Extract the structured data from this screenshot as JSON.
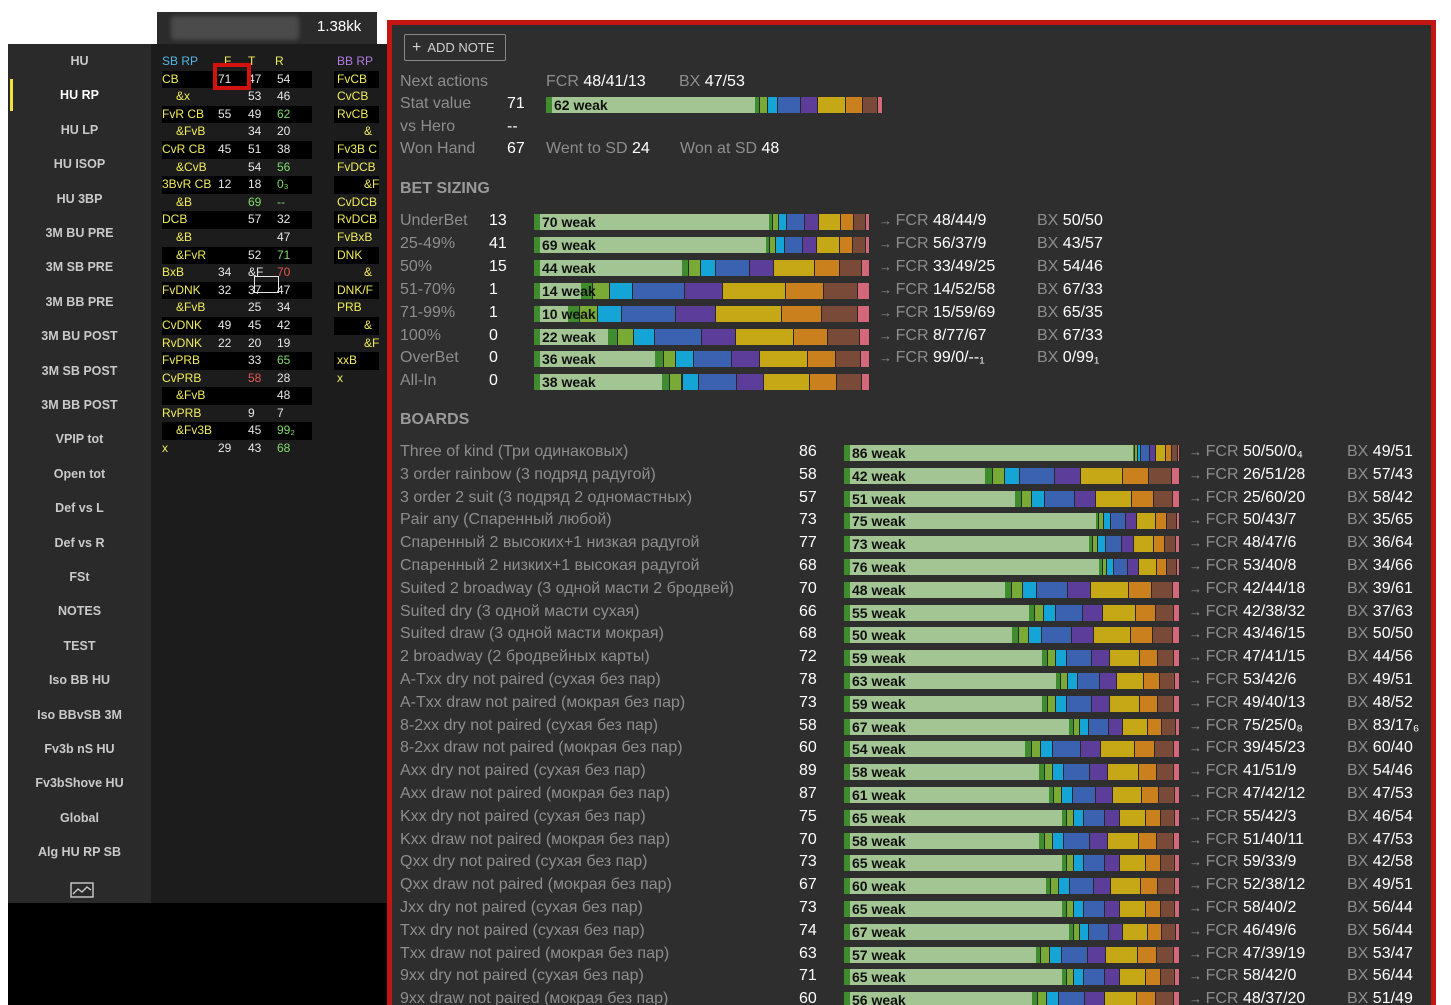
{
  "header": {
    "amount": "1.38kk"
  },
  "nav": {
    "items": [
      "HU",
      "HU RP",
      "HU LP",
      "HU ISOP",
      "HU 3BP",
      "3M BU PRE",
      "3M SB PRE",
      "3M BB PRE",
      "3M BU POST",
      "3M SB POST",
      "3M BB POST",
      "VPIP tot",
      "Open tot",
      "Def vs L",
      "Def vs R",
      "FSt",
      "NOTES",
      "TEST",
      "Iso BB HU",
      "Iso BBvSB 3M",
      "Fv3b nS HU",
      "Fv3bShove HU",
      "Global",
      "Alg HU RP SB"
    ],
    "active": "HU RP",
    "chart_icon": "line-chart-icon"
  },
  "grid_left": {
    "headers": [
      "SB RP",
      "F",
      "T",
      "R"
    ],
    "rows": [
      [
        "CB",
        "71",
        "47",
        "54"
      ],
      [
        "&x",
        "",
        "53",
        "46"
      ],
      [
        "FvR CB",
        "55",
        "49",
        "62"
      ],
      [
        "&FvB",
        "",
        "34",
        "20"
      ],
      [
        "CvR CB",
        "45",
        "51",
        "38"
      ],
      [
        "&CvB",
        "",
        "54",
        "56"
      ],
      [
        "3BvR CB",
        "12",
        "18",
        "0₃"
      ],
      [
        "&B",
        "",
        "69",
        "--"
      ],
      [
        "DCB",
        "",
        "57",
        "32"
      ],
      [
        "&B",
        "",
        "",
        "47"
      ],
      [
        "&FvR",
        "",
        "52",
        "71"
      ],
      [
        "BxB",
        "34",
        "&F",
        "70"
      ],
      [
        "FvDNK",
        "32",
        "37",
        "47"
      ],
      [
        "&FvB",
        "",
        "25",
        "34"
      ],
      [
        "CvDNK",
        "49",
        "45",
        "42"
      ],
      [
        "RvDNK",
        "22",
        "20",
        "19"
      ],
      [
        "FvPRB",
        "",
        "33",
        "65"
      ],
      [
        "CvPRB",
        "",
        "58",
        "28"
      ],
      [
        "&FvB",
        "",
        "",
        "48"
      ],
      [
        "RvPRB",
        "",
        "9",
        "7"
      ],
      [
        "&Fv3B",
        "",
        "45",
        "99₂"
      ],
      [
        "x",
        "29",
        "43",
        "68"
      ]
    ]
  },
  "grid_right": {
    "header": "BB RP",
    "rows": [
      "FvCB",
      "CvCB",
      "RvCB",
      "&",
      "Fv3B C",
      "FvDCB",
      "&F",
      "CvDCB",
      "RvDCB",
      "FvBxB",
      "DNK",
      "&",
      "DNK/F",
      "PRB",
      "&",
      "&Fv",
      "xxB",
      "x"
    ]
  },
  "popup": {
    "add_note": "ADD NOTE",
    "next_actions_label": "Next actions",
    "next_fcr": "48/41/13",
    "next_bx": "47/53",
    "stat_value_label": "Stat value",
    "stat_value": "71",
    "stat_weak": "62 weak",
    "stat_weak_pct": 62,
    "vs_hero_label": "vs Hero",
    "vs_hero": "--",
    "won_hand_label": "Won Hand",
    "won_hand": "67",
    "went_sd_label": "Went to SD",
    "went_sd": "24",
    "won_sd_label": "Won at SD",
    "won_sd": "48",
    "fcr_label": "FCR",
    "bx_label": "BX",
    "bet_sizing_title": "BET SIZING",
    "boards_title": "BOARDS",
    "colors": [
      "#3f8c2f",
      "#7aaa36",
      "#15a4d6",
      "#3a62b0",
      "#5d3d9a",
      "#c6a817",
      "#c9801d",
      "#7a4a38",
      "#d2687a"
    ],
    "sizing": [
      {
        "label": "UnderBet",
        "n": "13",
        "weak": "70 weak",
        "w": 70,
        "fcr": "48/44/9",
        "bx": "50/50"
      },
      {
        "label": "25-49%",
        "n": "41",
        "weak": "69 weak",
        "w": 69,
        "fcr": "56/37/9",
        "bx": "43/57"
      },
      {
        "label": "50%",
        "n": "15",
        "weak": "44 weak",
        "w": 44,
        "fcr": "33/49/25",
        "bx": "54/46"
      },
      {
        "label": "51-70%",
        "n": "1",
        "weak": "14 weak",
        "w": 14,
        "fcr": "14/52/58",
        "bx": "67/33"
      },
      {
        "label": "71-99%",
        "n": "1",
        "weak": "10 weak",
        "w": 10,
        "fcr": "15/59/69",
        "bx": "65/35"
      },
      {
        "label": "100%",
        "n": "0",
        "weak": "22 weak",
        "w": 22,
        "fcr": "8/77/67",
        "bx": "67/33"
      },
      {
        "label": "OverBet",
        "n": "0",
        "weak": "36 weak",
        "w": 36,
        "fcr": "99/0/--₁",
        "bx": "0/99₁"
      },
      {
        "label": "All-In",
        "n": "0",
        "weak": "38 weak",
        "w": 38,
        "fcr": "",
        "bx": ""
      }
    ],
    "boards": [
      {
        "label": "Three of kind (Три одинаковых)",
        "n": "86",
        "weak": "86 weak",
        "w": 86,
        "fcr": "50/50/0₄",
        "bx": "49/51"
      },
      {
        "label": "3 order rainbow (3 подряд радугой)",
        "n": "58",
        "weak": "42 weak",
        "w": 42,
        "fcr": "26/51/28",
        "bx": "57/43"
      },
      {
        "label": "3 order 2 suit (3 подряд 2 одномастных)",
        "n": "57",
        "weak": "51 weak",
        "w": 51,
        "fcr": "25/60/20",
        "bx": "58/42"
      },
      {
        "label": "Pair any (Спаренный любой)",
        "n": "73",
        "weak": "75 weak",
        "w": 75,
        "fcr": "50/43/7",
        "bx": "35/65"
      },
      {
        "label": "Спаренный 2 высоких+1 низкая радугой",
        "n": "77",
        "weak": "73 weak",
        "w": 73,
        "fcr": "48/47/6",
        "bx": "36/64"
      },
      {
        "label": "Спаренный 2 низких+1 высокая радугой",
        "n": "68",
        "weak": "76 weak",
        "w": 76,
        "fcr": "53/40/8",
        "bx": "34/66"
      },
      {
        "label": "Suited 2 broadway (3 одной масти 2 бродвей)",
        "n": "70",
        "weak": "48 weak",
        "w": 48,
        "fcr": "42/44/18",
        "bx": "39/61"
      },
      {
        "label": "Suited dry (3 одной масти сухая)",
        "n": "66",
        "weak": "55 weak",
        "w": 55,
        "fcr": "42/38/32",
        "bx": "37/63"
      },
      {
        "label": "Suited draw (3 одной масти мокрая)",
        "n": "68",
        "weak": "50 weak",
        "w": 50,
        "fcr": "43/46/15",
        "bx": "50/50"
      },
      {
        "label": "2 broadway (2 бродвейных карты)",
        "n": "72",
        "weak": "59 weak",
        "w": 59,
        "fcr": "47/41/15",
        "bx": "44/56"
      },
      {
        "label": "A-Txx  dry not paired (сухая без пар)",
        "n": "78",
        "weak": "63 weak",
        "w": 63,
        "fcr": "53/42/6",
        "bx": "49/51"
      },
      {
        "label": "A-Txx draw not paired (мокрая без пар)",
        "n": "73",
        "weak": "59 weak",
        "w": 59,
        "fcr": "49/40/13",
        "bx": "48/52"
      },
      {
        "label": "8-2xx dry not paired (сухая без пар)",
        "n": "58",
        "weak": "67 weak",
        "w": 67,
        "fcr": "75/25/0₈",
        "bx": "83/17₆"
      },
      {
        "label": "8-2xx draw not paired (мокрая без пар)",
        "n": "60",
        "weak": "54 weak",
        "w": 54,
        "fcr": "39/45/23",
        "bx": "60/40"
      },
      {
        "label": "Axx dry not paired (сухая без пар)",
        "n": "89",
        "weak": "58 weak",
        "w": 58,
        "fcr": "41/51/9",
        "bx": "54/46"
      },
      {
        "label": "Axx draw not paired (мокрая без пар)",
        "n": "87",
        "weak": "61 weak",
        "w": 61,
        "fcr": "47/42/12",
        "bx": "47/53"
      },
      {
        "label": "Kxx dry not paired (сухая без пар)",
        "n": "75",
        "weak": "65 weak",
        "w": 65,
        "fcr": "55/42/3",
        "bx": "46/54"
      },
      {
        "label": "Kxx draw not paired (мокрая без пар)",
        "n": "70",
        "weak": "58 weak",
        "w": 58,
        "fcr": "51/40/11",
        "bx": "47/53"
      },
      {
        "label": "Qxx dry not paired (сухая без пар)",
        "n": "73",
        "weak": "65 weak",
        "w": 65,
        "fcr": "59/33/9",
        "bx": "42/58"
      },
      {
        "label": "Qxx draw not paired (мокрая без пар)",
        "n": "67",
        "weak": "60 weak",
        "w": 60,
        "fcr": "52/38/12",
        "bx": "49/51"
      },
      {
        "label": "Jxx dry not paired (сухая без пар)",
        "n": "73",
        "weak": "65 weak",
        "w": 65,
        "fcr": "58/40/2",
        "bx": "56/44"
      },
      {
        "label": "Txx dry not paired (сухая без пар)",
        "n": "74",
        "weak": "67 weak",
        "w": 67,
        "fcr": "46/49/6",
        "bx": "56/44"
      },
      {
        "label": "Txx draw not paired (мокрая без пар)",
        "n": "63",
        "weak": "57 weak",
        "w": 57,
        "fcr": "47/39/19",
        "bx": "53/47"
      },
      {
        "label": "9xx dry not paired (сухая без пар)",
        "n": "71",
        "weak": "65 weak",
        "w": 65,
        "fcr": "58/42/0",
        "bx": "56/44"
      },
      {
        "label": "9xx draw not paired (мокрая без пар)",
        "n": "60",
        "weak": "56 weak",
        "w": 56,
        "fcr": "48/37/20",
        "bx": "51/49"
      }
    ]
  }
}
